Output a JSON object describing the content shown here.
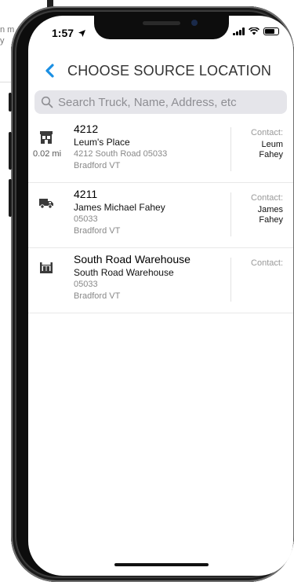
{
  "background": {
    "snippet_line1": "n m",
    "snippet_line2": "y"
  },
  "status_bar": {
    "time": "1:57"
  },
  "nav": {
    "title": "CHOOSE SOURCE LOCATION"
  },
  "search": {
    "placeholder": "Search Truck, Name, Address, etc"
  },
  "contact_label": "Contact:",
  "locations": [
    {
      "icon": "store-icon",
      "id": "4212",
      "name": "Leum's Place",
      "address_line1": "4212 South Road 05033",
      "address_line2": "Bradford VT",
      "distance": "0.02 mi",
      "contact_line1": "Leum",
      "contact_line2": "Fahey"
    },
    {
      "icon": "truck-icon",
      "id": "4211",
      "name": "James Michael Fahey",
      "address_line1": "05033",
      "address_line2": "Bradford VT",
      "distance": "",
      "contact_line1": "James",
      "contact_line2": "Fahey"
    },
    {
      "icon": "warehouse-icon",
      "id": "South Road Warehouse",
      "name": "South Road Warehouse",
      "address_line1": "05033",
      "address_line2": "Bradford VT",
      "distance": "",
      "contact_line1": "",
      "contact_line2": ""
    }
  ],
  "colors": {
    "accent": "#1a8fe3",
    "search_bg": "#e5e5ea"
  }
}
